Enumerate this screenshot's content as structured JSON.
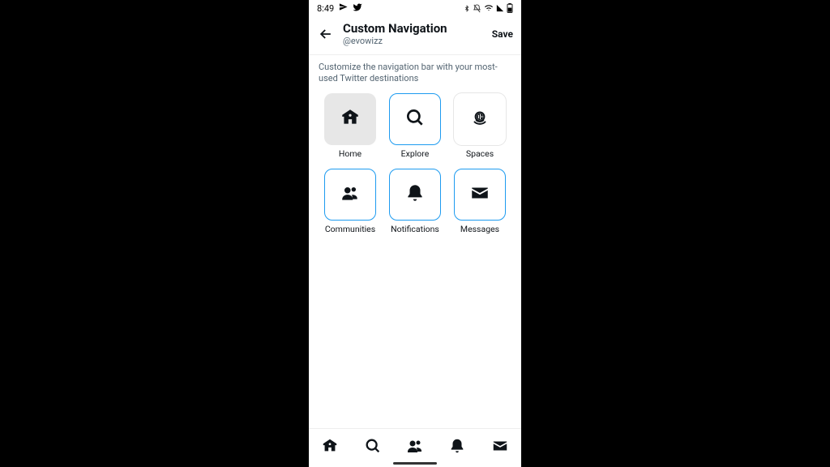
{
  "status": {
    "time": "8:49"
  },
  "header": {
    "title": "Custom Navigation",
    "handle": "@evowizz",
    "save_label": "Save"
  },
  "description": "Customize the navigation bar with your most-used Twitter destinations",
  "tiles": [
    {
      "label": "Home"
    },
    {
      "label": "Explore"
    },
    {
      "label": "Spaces"
    },
    {
      "label": "Communities"
    },
    {
      "label": "Notifications"
    },
    {
      "label": "Messages"
    }
  ]
}
